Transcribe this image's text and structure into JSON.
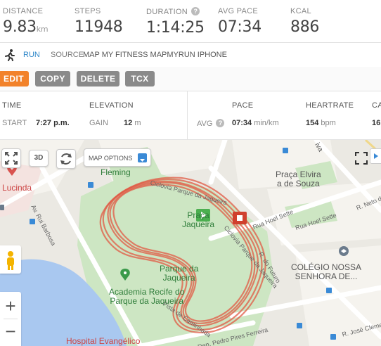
{
  "stats": [
    {
      "label": "DISTANCE",
      "value": "9.83",
      "unit": "km"
    },
    {
      "label": "STEPS",
      "value": "11948",
      "unit": ""
    },
    {
      "label": "DURATION",
      "value": "1:14:25",
      "unit": ""
    },
    {
      "label": "AVG PACE",
      "value": "07:34",
      "unit": ""
    },
    {
      "label": "KCAL",
      "value": "886",
      "unit": ""
    }
  ],
  "help_glyph": "?",
  "activity": {
    "type": "RUN",
    "source_label": "SOURCE",
    "source_value": "MAP MY FITNESS MAPMYRUN IPHONE"
  },
  "actions": [
    "EDIT",
    "COPY",
    "DELETE",
    "TCX"
  ],
  "metrics": {
    "time": {
      "header": "TIME",
      "label": "START",
      "value": "7:27 p.m."
    },
    "elevation": {
      "header": "ELEVATION",
      "label": "GAIN",
      "value": "12",
      "unit": "m"
    },
    "pace": {
      "header": "PACE",
      "label": "AVG",
      "value": "07:34",
      "unit": "min/km"
    },
    "heartrate": {
      "header": "HEARTRATE",
      "value": "154",
      "unit": "bpm"
    },
    "cut_header": "CA",
    "cut_value": "16"
  },
  "map": {
    "options_label": "MAP OPTIONS",
    "threed_label": "3D",
    "zoom_in": "+",
    "zoom_out": "−",
    "labels": {
      "fleming": "Fleming",
      "praca_elvira": "Praça Elvira\na de Souza",
      "lucinda": "Lucinda",
      "praca_jaqueira": "Praça\nJaqueira",
      "parque": "Parque da\nJaqueira",
      "academia": "Academia Recife do\nParque da Jaqueira",
      "colegio": "COLÉGIO NOSSA\nSENHORA DE...",
      "hospital": "Hospital Evangélico",
      "av_rui": "Av. Rui Barbosa",
      "rua_hoel": "Rua Hoel Sette",
      "rua_hoel2": "Rua Hoel Sette",
      "r_futuro": "R. do Futuro",
      "r_neto": "R. Neto d",
      "r_jose": "R. José Clemen",
      "dep_pedro": "Dep. Pedro Pires Ferreira",
      "ciclovia1": "Ciclovia Parque da Jaqueira",
      "ciclovia2": "Ciclovia Parque da Jaqueira",
      "pista": "Pista de Caminhada",
      "top_cut": "iva"
    }
  },
  "colors": {
    "accent": "#f2822a",
    "button_gray": "#8a8a8a",
    "route": "#e05a44",
    "link": "#2e87c9",
    "park": "#cde6c3"
  }
}
